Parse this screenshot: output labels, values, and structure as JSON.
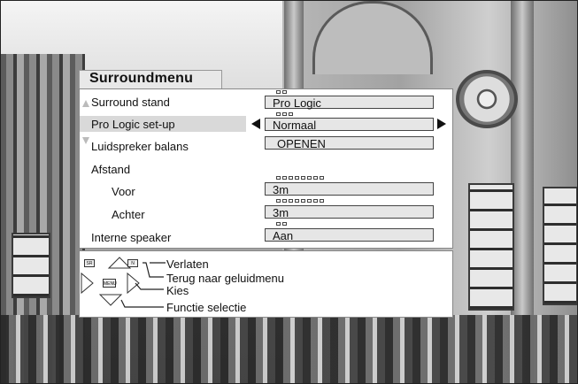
{
  "menu": {
    "title": "Surroundmenu",
    "rows": [
      {
        "label": "Surround stand",
        "value": "Pro Logic"
      },
      {
        "label": "Pro Logic set-up",
        "value": "Normaal"
      },
      {
        "label": "Luidspreker balans",
        "value": "OPENEN"
      },
      {
        "label": "Afstand",
        "value": ""
      },
      {
        "label": "Voor",
        "value": "3m"
      },
      {
        "label": "Achter",
        "value": "3m"
      },
      {
        "label": "Interne speaker",
        "value": "Aan"
      }
    ]
  },
  "help": {
    "exit_label": "Verlaten",
    "back_label": "Terug naar geluidmenu",
    "select_label": "Kies",
    "function_label": "Functie selectie",
    "key_sr": "SR",
    "key_menu": "MENU",
    "key_n": "N"
  },
  "colors": {
    "panel_bg": "#ffffff",
    "highlight": "#d9d9d9",
    "value_box": "#e6e6e6",
    "text": "#111111"
  },
  "icons": [
    "scroll-up-icon",
    "scroll-down-icon",
    "arrow-left-icon",
    "arrow-right-icon",
    "nav-up-icon",
    "nav-down-icon",
    "nav-left-icon",
    "nav-right-icon"
  ]
}
